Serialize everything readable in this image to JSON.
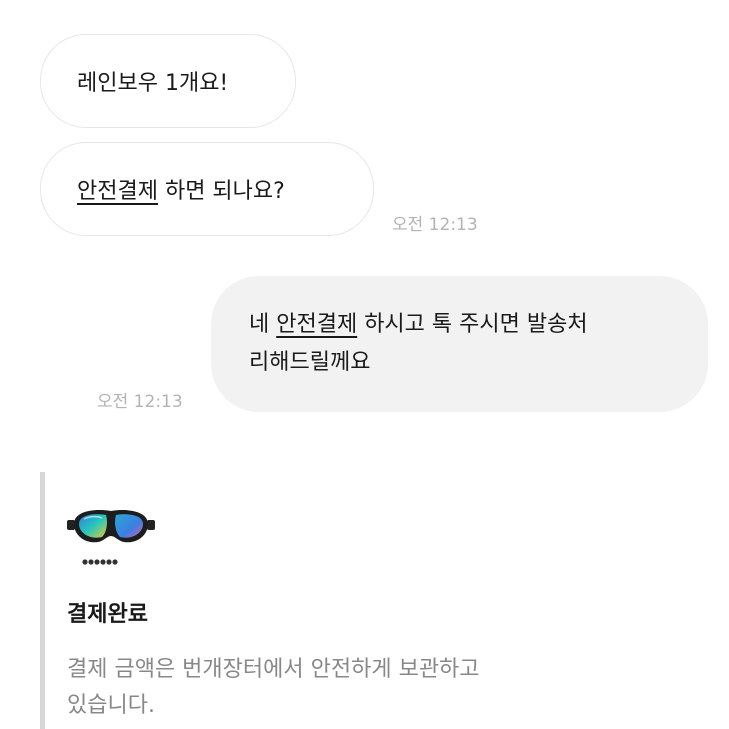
{
  "messages": {
    "incoming": [
      {
        "text": "레인보우 1개요!"
      },
      {
        "link": "안전결제",
        "rest": " 하면 되나요?",
        "time": "오전 12:13"
      }
    ],
    "outgoing": {
      "prefix": "네 ",
      "link": "안전결제",
      "rest_line1": " 하시고 톡 주시면 발송처",
      "line2": "리해드릴께요",
      "time": "오전 12:13"
    }
  },
  "payment_card": {
    "title": "결제완료",
    "description_line1": "결제 금액은 번개장터에서 안전하게 보관하고",
    "description_line2": "있습니다.",
    "thumbnail_icon": "ski-goggles-image"
  },
  "colors": {
    "timestamp": "#b3b3b3",
    "outgoing_bubble": "#f2f2f2",
    "card_bar": "#d7d7d7",
    "description_text": "#888888"
  }
}
